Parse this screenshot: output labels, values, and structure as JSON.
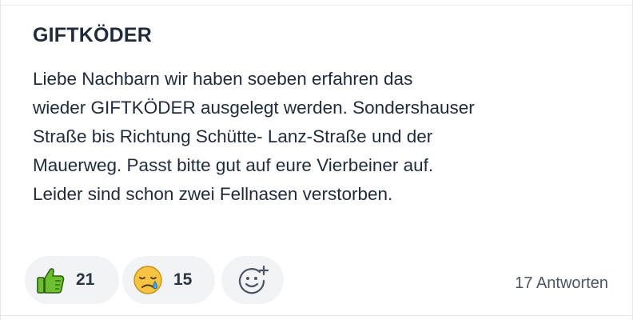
{
  "post": {
    "title": "GIFTKÖDER",
    "body_lines": [
      "Liebe Nachbarn wir haben soeben erfahren das",
      "wieder GIFTKÖDER ausgelegt werden. Sondershauser",
      "Straße bis Richtung Schütte- Lanz-Straße und der",
      "Mauerweg. Passt bitte gut auf eure Vierbeiner auf.",
      "Leider sind schon zwei Fellnasen verstorben."
    ]
  },
  "reactions": {
    "like": {
      "icon": "thumbs-up-icon",
      "count": "21"
    },
    "sad": {
      "icon": "sad-tear-face-icon",
      "count": "15"
    },
    "add": {
      "icon": "add-reaction-icon"
    }
  },
  "replies_label": "17 Antworten",
  "colors": {
    "thumb_green": "#6cbf2f",
    "face_yellow": "#f6c343",
    "tear_blue": "#49a5e6",
    "pill_bg": "#f1f3f5",
    "text_dark": "#1f2b3a"
  }
}
